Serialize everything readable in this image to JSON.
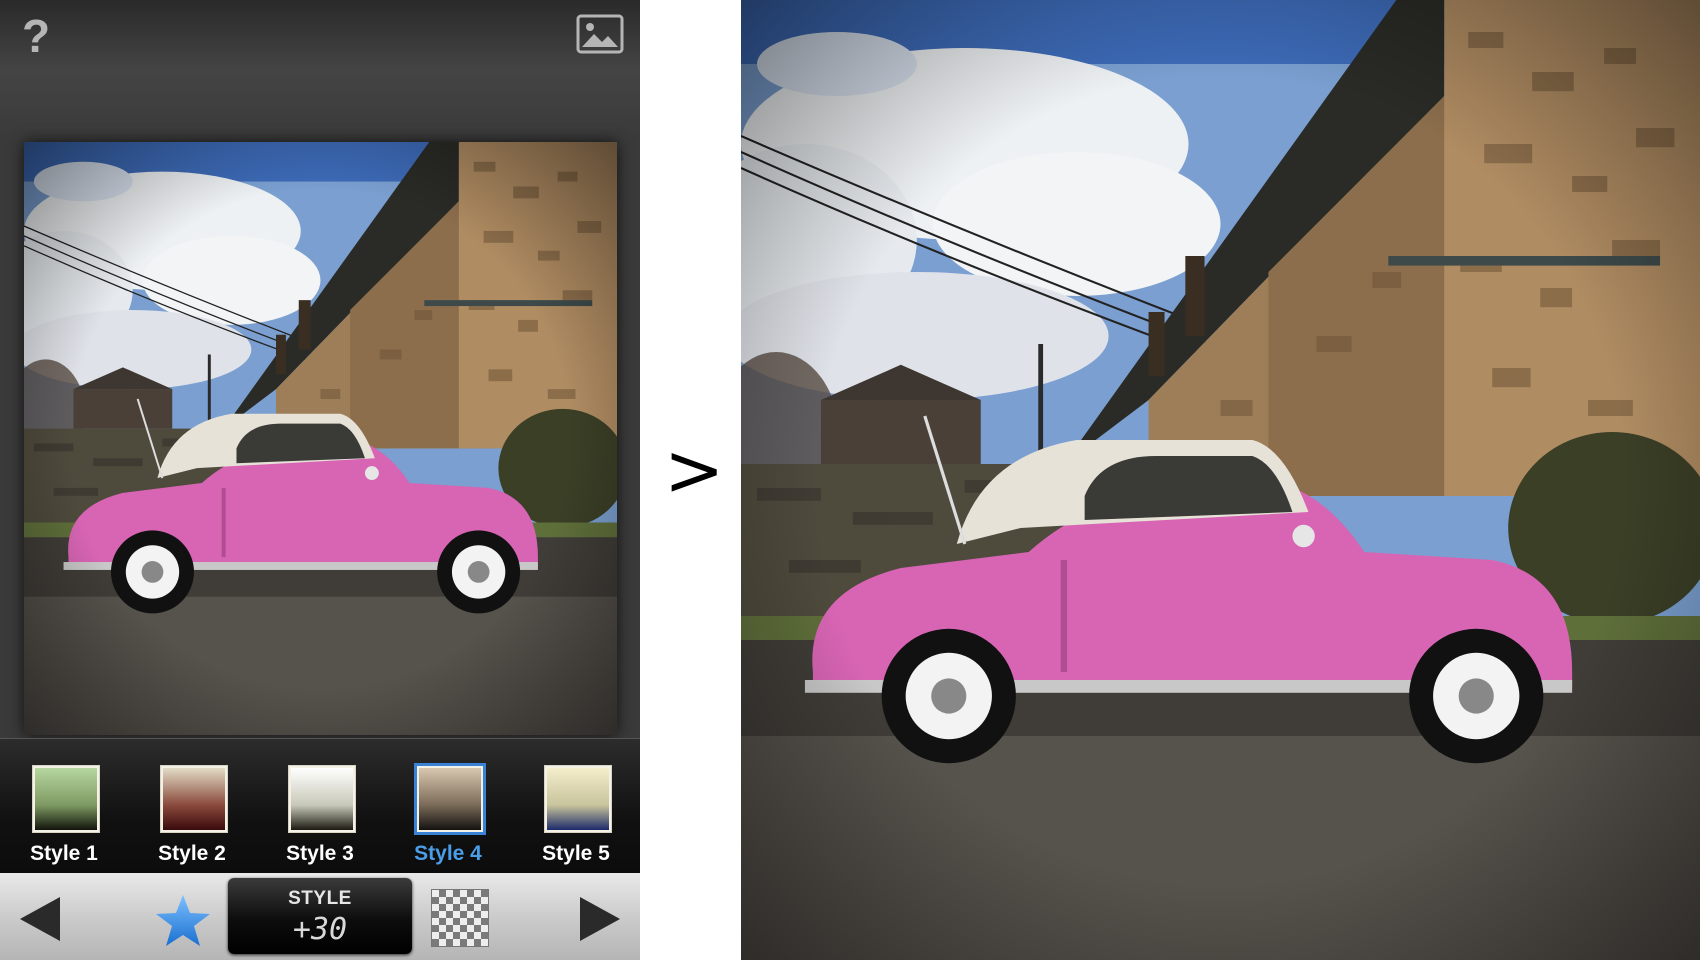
{
  "app": {
    "help_label": "?",
    "gallery_icon": "image-icon"
  },
  "styles": [
    {
      "label": "Style 1",
      "top": "#b6d7a0",
      "mid": "#7e9a62",
      "bottom": "#11140c",
      "selected": false
    },
    {
      "label": "Style 2",
      "top": "#e2dcc6",
      "mid": "#8a4a3c",
      "bottom": "#3a0a0c",
      "selected": false
    },
    {
      "label": "Style 3",
      "top": "#ffffff",
      "mid": "#c8c8b8",
      "bottom": "#1a1a12",
      "selected": false
    },
    {
      "label": "Style 4",
      "top": "#d8c8b0",
      "mid": "#7a6a58",
      "bottom": "#141210",
      "selected": true
    },
    {
      "label": "Style 5",
      "top": "#f4eecc",
      "mid": "#c8c49c",
      "bottom": "#1c2a6a",
      "selected": false
    }
  ],
  "toolbar": {
    "param_name": "STYLE",
    "param_value": "+30",
    "prev_icon": "left-arrow-icon",
    "favorite_icon": "star-icon",
    "compare_icon": "checkerboard-icon",
    "next_icon": "right-arrow-icon"
  },
  "separator": ">",
  "colors": {
    "accent": "#3a82d6",
    "car": "#d865b4",
    "roof": "#e7e2d8"
  }
}
